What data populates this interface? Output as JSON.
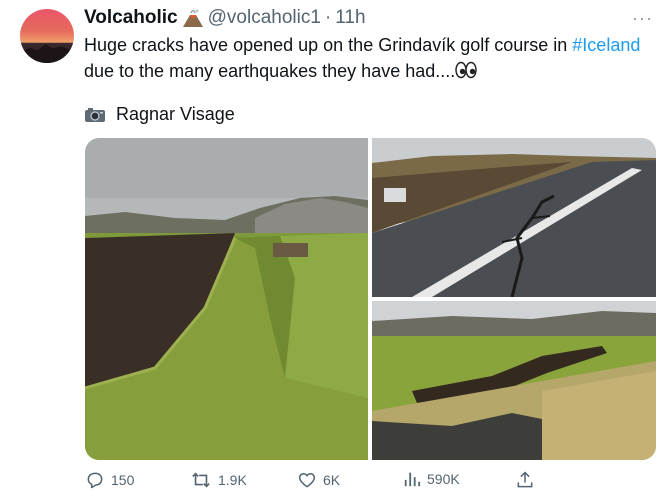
{
  "tweet": {
    "display_name": "Volcaholic",
    "name_emoji": "volcano-emoji",
    "handle": "@volcaholic1",
    "separator": "·",
    "timestamp": "11h",
    "more": "···",
    "text_before": "Huge cracks have opened up on the Grindavík golf course in ",
    "hashtag": "#Iceland",
    "text_after": " due to the many earthquakes they have had....",
    "text_emoji": "eyes-emoji",
    "photo_credit_icon": "camera-emoji",
    "photo_credit": "Ragnar Visage"
  },
  "photos": [
    {
      "subject": "grassy cracked fairway trench"
    },
    {
      "subject": "cracked wet asphalt road"
    },
    {
      "subject": "sunken turf crack across golf course"
    }
  ],
  "actions": {
    "replies": "150",
    "reposts": "1.9K",
    "likes": "6K",
    "views": "590K"
  },
  "colors": {
    "hashtag": "#1d9bf0",
    "muted": "#536471",
    "text": "#0f1419"
  }
}
